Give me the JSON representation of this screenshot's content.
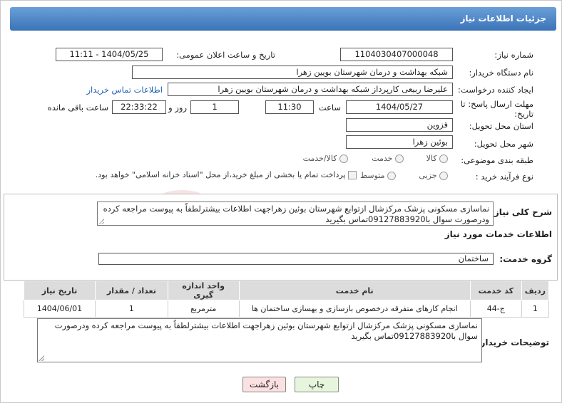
{
  "header": {
    "title": "جزئیات اطلاعات نیاز"
  },
  "form": {
    "need_number_label": "شماره نیاز:",
    "need_number": "1104030407000048",
    "announce_label": "تاریخ و ساعت اعلان عمومی:",
    "announce_value": "1404/05/25 - 11:11",
    "buyer_org_label": "نام دستگاه خریدار:",
    "buyer_org": "شبکه بهداشت و درمان شهرستان بویین زهرا",
    "creator_label": "ایجاد کننده درخواست:",
    "creator": "علیرضا ربیعی کارپرداز شبکه بهداشت و درمان شهرستان بویین زهرا",
    "contact_link": "اطلاعات تماس خریدار",
    "deadline_label_1": "مهلت ارسال پاسخ: تا",
    "deadline_label_2": "تاریخ:",
    "deadline_date": "1404/05/27",
    "time_label": "ساعت",
    "deadline_time": "11:30",
    "days_value": "1",
    "days_label": "روز و",
    "remaining_time": "22:33:22",
    "remaining_label": "ساعت باقی مانده",
    "province_label": "استان محل تحویل:",
    "province": "قزوین",
    "city_label": "شهر محل تحویل:",
    "city": "بوئین زهرا",
    "category_label": "طبقه بندی موضوعی:",
    "category_options": [
      "کالا",
      "خدمت",
      "کالا/خدمت"
    ],
    "category_selected": "خدمت",
    "process_label": "نوع فرآیند خرید :",
    "process_options": [
      "جزیی",
      "متوسط"
    ],
    "process_selected": "جزیی",
    "payment_note": "پرداخت تمام یا بخشی از مبلغ خرید،از محل \"اسناد خزانه اسلامی\" خواهد بود."
  },
  "summary": {
    "label": "شرح کلی نیاز:",
    "text": "نماسازی مسکونی پزشک مرکزشال ازتوابع شهرستان بوئین زهراجهت اطلاعات بیشترلطفاً به پیوست مراجعه کرده ودرصورت سوال با09127883920تماس بگیرید"
  },
  "services": {
    "section_title": "اطلاعات خدمات مورد نیاز",
    "group_label": "گروه خدمت:",
    "group_value": "ساختمان",
    "columns": [
      "ردیف",
      "کد خدمت",
      "نام خدمت",
      "واحد اندازه گیری",
      "تعداد / مقدار",
      "تاریخ نیاز"
    ],
    "rows": [
      [
        "1",
        "ج-44",
        "انجام کارهای متفرقه درخصوص بازسازی و بهسازی ساختمان ها",
        "مترمربع",
        "1",
        "1404/06/01"
      ]
    ]
  },
  "buyer_notes": {
    "label": "توضیحات خریدار:",
    "text": "نماسازی مسکونی پزشک مرکزشال ازتوابع شهرستان بوئین زهراجهت اطلاعات بیشترلطفاً به پیوست مراجعه کرده ودرصورت سوال با09127883920تماس بگیرید"
  },
  "buttons": {
    "print": "چاپ",
    "back": "بازگشت"
  },
  "colors": {
    "header_top": "#6a9fd8",
    "header_bottom": "#3a73b8",
    "link": "#1a5fb4",
    "print_btn": "#e6f6dc",
    "back_btn": "#fbe1e1"
  }
}
